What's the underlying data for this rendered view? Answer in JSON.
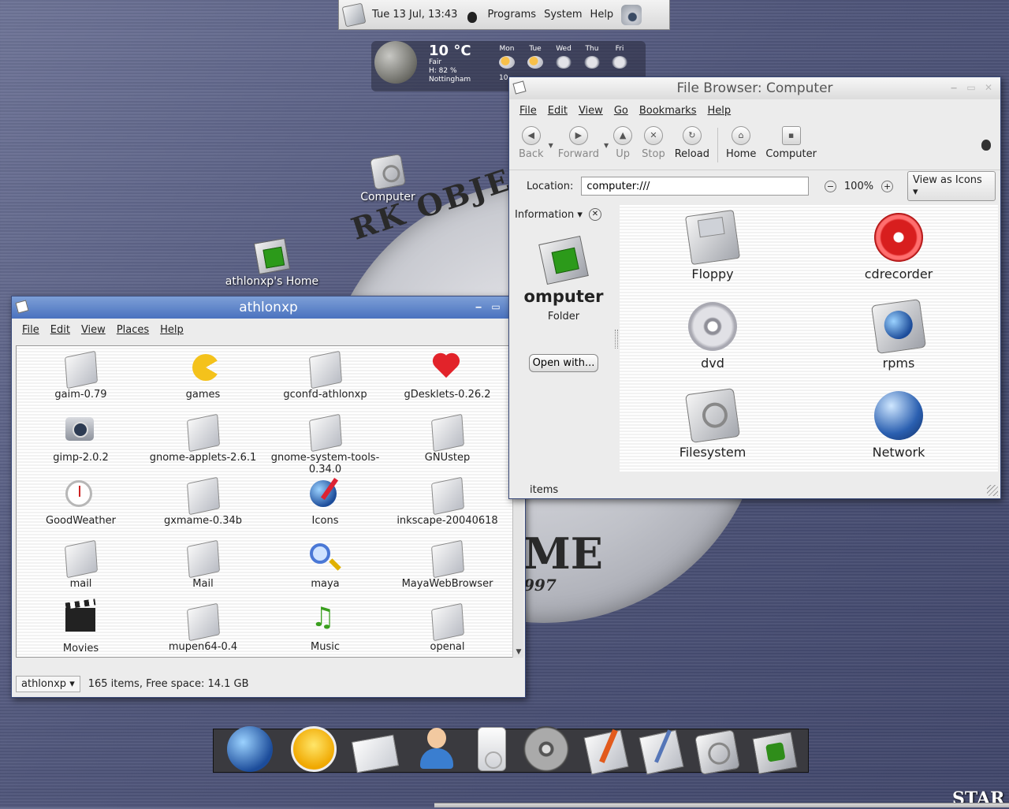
{
  "wallpaper": {
    "text_1": "RK OBJECT",
    "text_2": "ME",
    "text_3": "997",
    "text_4": "STAR"
  },
  "top_panel": {
    "clock": "Tue 13 Jul, 13:43",
    "menus": [
      "Programs",
      "System",
      "Help"
    ]
  },
  "weather": {
    "temp": "10 °C",
    "condition": "Fair",
    "humidity": "H: 82 %",
    "city": "Nottingham",
    "low": "10",
    "days": [
      "Mon",
      "Tue",
      "Wed",
      "Thu",
      "Fri"
    ]
  },
  "desktop": {
    "computer_label": "Computer",
    "home_label": "athlonxp's Home"
  },
  "athlon_window": {
    "title": "athlonxp",
    "menus": [
      "File",
      "Edit",
      "View",
      "Places",
      "Help"
    ],
    "items": [
      {
        "label": "gaim-0.79",
        "icon": "folder-icon"
      },
      {
        "label": "games",
        "icon": "pacman-icon"
      },
      {
        "label": "gconfd-athlonxp",
        "icon": "folder-icon"
      },
      {
        "label": "gDesklets-0.26.2",
        "icon": "heart-icon"
      },
      {
        "label": "gimp-2.0.2",
        "icon": "camera-icon"
      },
      {
        "label": "gnome-applets-2.6.1",
        "icon": "folder-icon"
      },
      {
        "label": "gnome-system-tools-0.34.0",
        "icon": "folder-icon"
      },
      {
        "label": "GNUstep",
        "icon": "folder-icon"
      },
      {
        "label": "GoodWeather",
        "icon": "clock-icon"
      },
      {
        "label": "gxmame-0.34b",
        "icon": "folder-icon"
      },
      {
        "label": "Icons",
        "icon": "globe-brush-icon"
      },
      {
        "label": "inkscape-20040618",
        "icon": "folder-icon"
      },
      {
        "label": "mail",
        "icon": "folder-icon"
      },
      {
        "label": "Mail",
        "icon": "folder-icon"
      },
      {
        "label": "maya",
        "icon": "magnifier-icon"
      },
      {
        "label": "MayaWebBrowser",
        "icon": "folder-icon"
      },
      {
        "label": "Movies",
        "icon": "clapperboard-icon"
      },
      {
        "label": "mupen64-0.4",
        "icon": "folder-icon"
      },
      {
        "label": "Music",
        "icon": "music-note-icon"
      },
      {
        "label": "openal",
        "icon": "folder-icon"
      }
    ],
    "place": "athlonxp",
    "status": "165 items, Free space: 14.1 GB"
  },
  "file_browser": {
    "title": "File Browser: Computer",
    "menus": [
      "File",
      "Edit",
      "View",
      "Go",
      "Bookmarks",
      "Help"
    ],
    "toolbar": {
      "back": "Back",
      "forward": "Forward",
      "up": "Up",
      "stop": "Stop",
      "reload": "Reload",
      "home": "Home",
      "computer": "Computer"
    },
    "location_label": "Location:",
    "location_value": "computer:///",
    "zoom": "100%",
    "view_mode": "View as Icons",
    "side_pane": {
      "header": "Information",
      "title": "omputer",
      "type": "Folder",
      "open_with": "Open with...",
      "items_label": "items"
    },
    "items": [
      {
        "label": "Floppy",
        "icon": "floppy-icon"
      },
      {
        "label": "cdrecorder",
        "icon": "cdrecorder-icon"
      },
      {
        "label": "dvd",
        "icon": "dvd-icon"
      },
      {
        "label": "rpms",
        "icon": "rpms-drive-icon"
      },
      {
        "label": "Filesystem",
        "icon": "filesystem-icon"
      },
      {
        "label": "Network",
        "icon": "network-icon"
      }
    ]
  }
}
